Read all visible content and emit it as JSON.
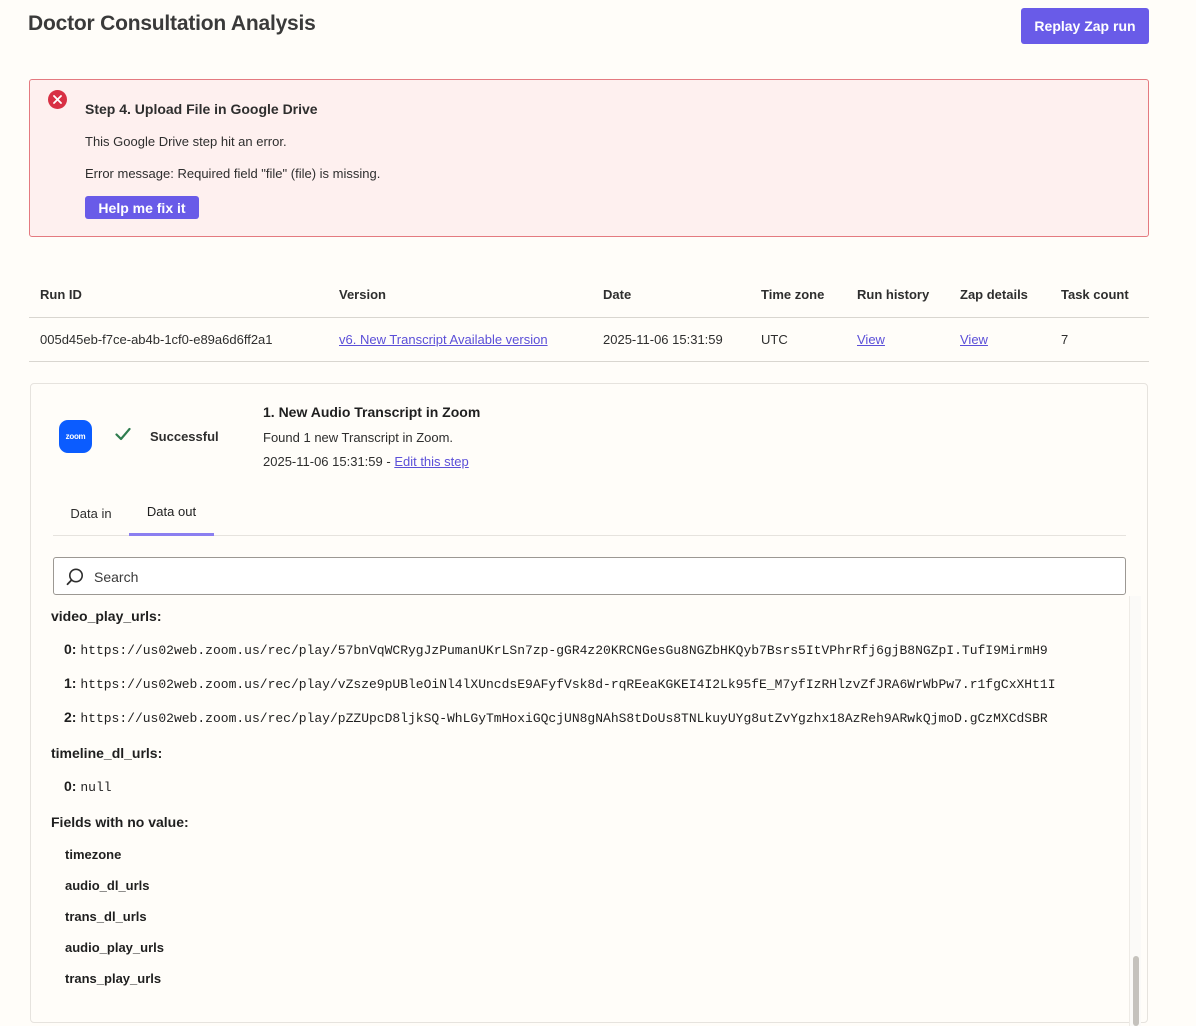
{
  "header": {
    "title": "Doctor Consultation Analysis",
    "replay_label": "Replay Zap run"
  },
  "error": {
    "title": "Step 4. Upload File in Google Drive",
    "line1": "This Google Drive step hit an error.",
    "line2": "Error message: Required field \"file\" (file) is missing.",
    "fix_label": "Help me fix it",
    "color": "#d83044"
  },
  "run_table": {
    "headers": [
      "Run ID",
      "Version",
      "Date",
      "Time zone",
      "Run history",
      "Zap details",
      "Task count"
    ],
    "row": {
      "run_id": "005d45eb-f7ce-ab4b-1cf0-e89a6d6ff2a1",
      "version": "v6. New Transcript Available version",
      "date": "2025-11-06 15:31:59",
      "timezone": "UTC",
      "run_history": "View",
      "zap_details": "View",
      "task_count": "7"
    }
  },
  "step": {
    "logo_text": "zoom",
    "status": "Successful",
    "title": "1. New Audio Transcript in Zoom",
    "description": "Found 1 new Transcript in Zoom.",
    "date": "2025-11-06 15:31:59",
    "date_separator": " - ",
    "edit_link": "Edit this step"
  },
  "tabs": [
    {
      "label": "Data in",
      "active": false
    },
    {
      "label": "Data out",
      "active": true
    }
  ],
  "search": {
    "placeholder": "Search"
  },
  "data_out": {
    "video_play_urls_label": "video_play_urls:",
    "video_play_urls": [
      {
        "key": "0:",
        "value": "https://us02web.zoom.us/rec/play/57bnVqWCRygJzPumanUKrLSn7zp-gGR4z20KRCNGesGu8NGZbHKQyb7Bsrs5ItVPhrRfj6gjB8NGZpI.TufI9MirmH9"
      },
      {
        "key": "1:",
        "value": "https://us02web.zoom.us/rec/play/vZsze9pUBleOiNl4lXUncdsE9AFyfVsk8d-rqREeaKGKEI4I2Lk95fE_M7yfIzRHlzvZfJRA6WrWbPw7.r1fgCxXHt1I"
      },
      {
        "key": "2:",
        "value": "https://us02web.zoom.us/rec/play/pZZUpcD8ljkSQ-WhLGyTmHoxiGQcjUN8gNAhS8tDoUs8TNLkuyUYg8utZvYgzhx18AzReh9ARwkQjmoD.gCzMXCdSBR"
      }
    ],
    "timeline_dl_urls_label": "timeline_dl_urls:",
    "timeline_dl_urls": [
      {
        "key": "0:",
        "value": "null"
      }
    ],
    "no_value_label": "Fields with no value:",
    "no_value_fields": [
      "timezone",
      "audio_dl_urls",
      "trans_dl_urls",
      "audio_play_urls",
      "trans_play_urls"
    ]
  },
  "colors": {
    "accent": "#695be8",
    "link": "#5b4fd8",
    "success": "#2f7d4f",
    "zoom_blue": "#0b5cff",
    "error_bg": "#fef0ef",
    "error_border": "#e47a80"
  }
}
